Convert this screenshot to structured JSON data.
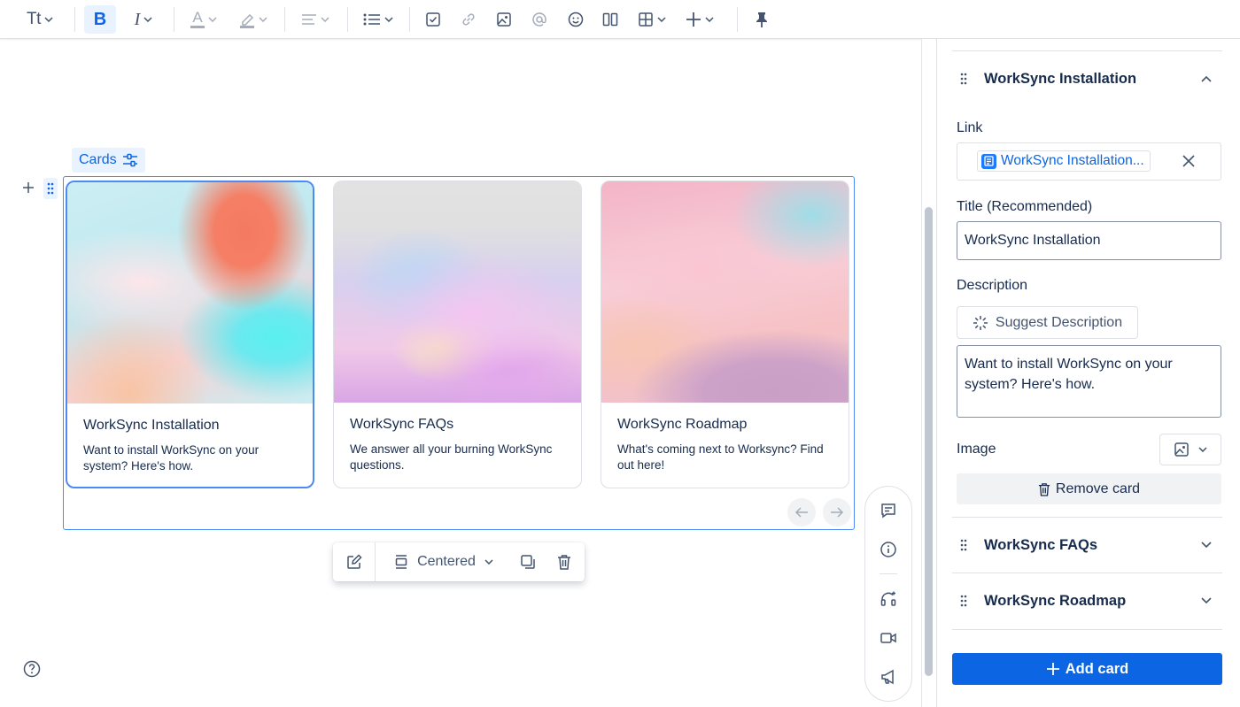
{
  "toolbar": {
    "text_style_label": "Tt",
    "bold_label": "B",
    "italic_label": "I",
    "font_color_label": "A"
  },
  "editor": {
    "block_label": "Cards",
    "cards": [
      {
        "title": "WorkSync Installation",
        "description": "Want to install WorkSync on your system? Here's how."
      },
      {
        "title": "WorkSync FAQs",
        "description": "We answer all your burning WorkSync questions."
      },
      {
        "title": "WorkSync Roadmap",
        "description": "What's coming next to Worksync? Find out here!"
      }
    ],
    "floating_toolbar": {
      "layout_label": "Centered"
    }
  },
  "panel": {
    "expanded": {
      "title": "WorkSync Installation",
      "link_label": "Link",
      "link_value": "WorkSync Installation...",
      "title_label": "Title (Recommended)",
      "title_value": "WorkSync Installation",
      "description_label": "Description",
      "suggest_label": "Suggest Description",
      "description_value": "Want to install WorkSync on your system? Here's how.",
      "image_label": "Image",
      "remove_label": "Remove card"
    },
    "collapsed": [
      {
        "title": "WorkSync FAQs"
      },
      {
        "title": "WorkSync Roadmap"
      }
    ],
    "add_card_label": "Add card"
  },
  "colors": {
    "accent": "#0c66e4",
    "selection": "#4c8bf5",
    "text": "#172b4d",
    "subtle": "#44546f"
  }
}
